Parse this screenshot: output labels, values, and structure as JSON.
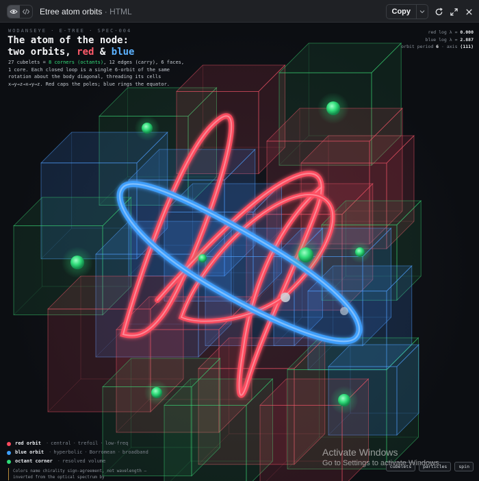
{
  "topbar": {
    "title": "Etree atom orbits",
    "separator": "·",
    "kind": "HTML",
    "copy_label": "Copy",
    "icons": [
      "eye-icon",
      "code-icon",
      "chevron-down-icon",
      "refresh-icon",
      "expand-icon",
      "close-icon"
    ]
  },
  "header": {
    "eyebrow": "WODANSEYE · E-TREE · SPEC-004",
    "title_line1": "The atom of the node:",
    "title_line2_a": "two orbits,",
    "title_red": "red",
    "title_amp": "&",
    "title_blue": "blue",
    "desc_a": "27 cubelets =",
    "desc_corners": "8 corners (octants)",
    "desc_b": ", 12 edges (carry), 6 faces, 1 core. Each closed loop is a single 6-orbit of the same rotation about the body diagonal, threading its cells x→y→z→x→y→z. Red caps the poles; blue rings the equator."
  },
  "readout": {
    "red_label": "red  log λ =",
    "red_value": "0.000",
    "blue_label": "blue log λ =",
    "blue_value": "2.887",
    "period_label": "orbit period",
    "period_value": "6",
    "axis_label": "· axis",
    "axis_value": "⟨111⟩"
  },
  "legend": [
    {
      "name": "red orbit",
      "notes": [
        "central",
        "trefoil",
        "low-freq"
      ],
      "color": "#ff4a5e"
    },
    {
      "name": "blue orbit",
      "notes": [
        "hyperbolic",
        "Borromean",
        "broadband"
      ],
      "color": "#3da0ff"
    },
    {
      "name": "octant corner",
      "notes": [
        "resolved volume"
      ],
      "color": "#2fdc78"
    }
  ],
  "caption": "Colors name chirality sign-agreement, not wavelength — inverted from the optical spectrum by",
  "buttons": {
    "cubelets": "cubelets",
    "particles": "particles",
    "spin": "spin"
  },
  "watermark": {
    "line1": "Activate Windows",
    "line2": "Go to Settings to activate Windows."
  },
  "colors": {
    "red": "#ff4a5e",
    "blue": "#3da0ff",
    "green": "#2fdc78",
    "background": "#0b0d10"
  }
}
